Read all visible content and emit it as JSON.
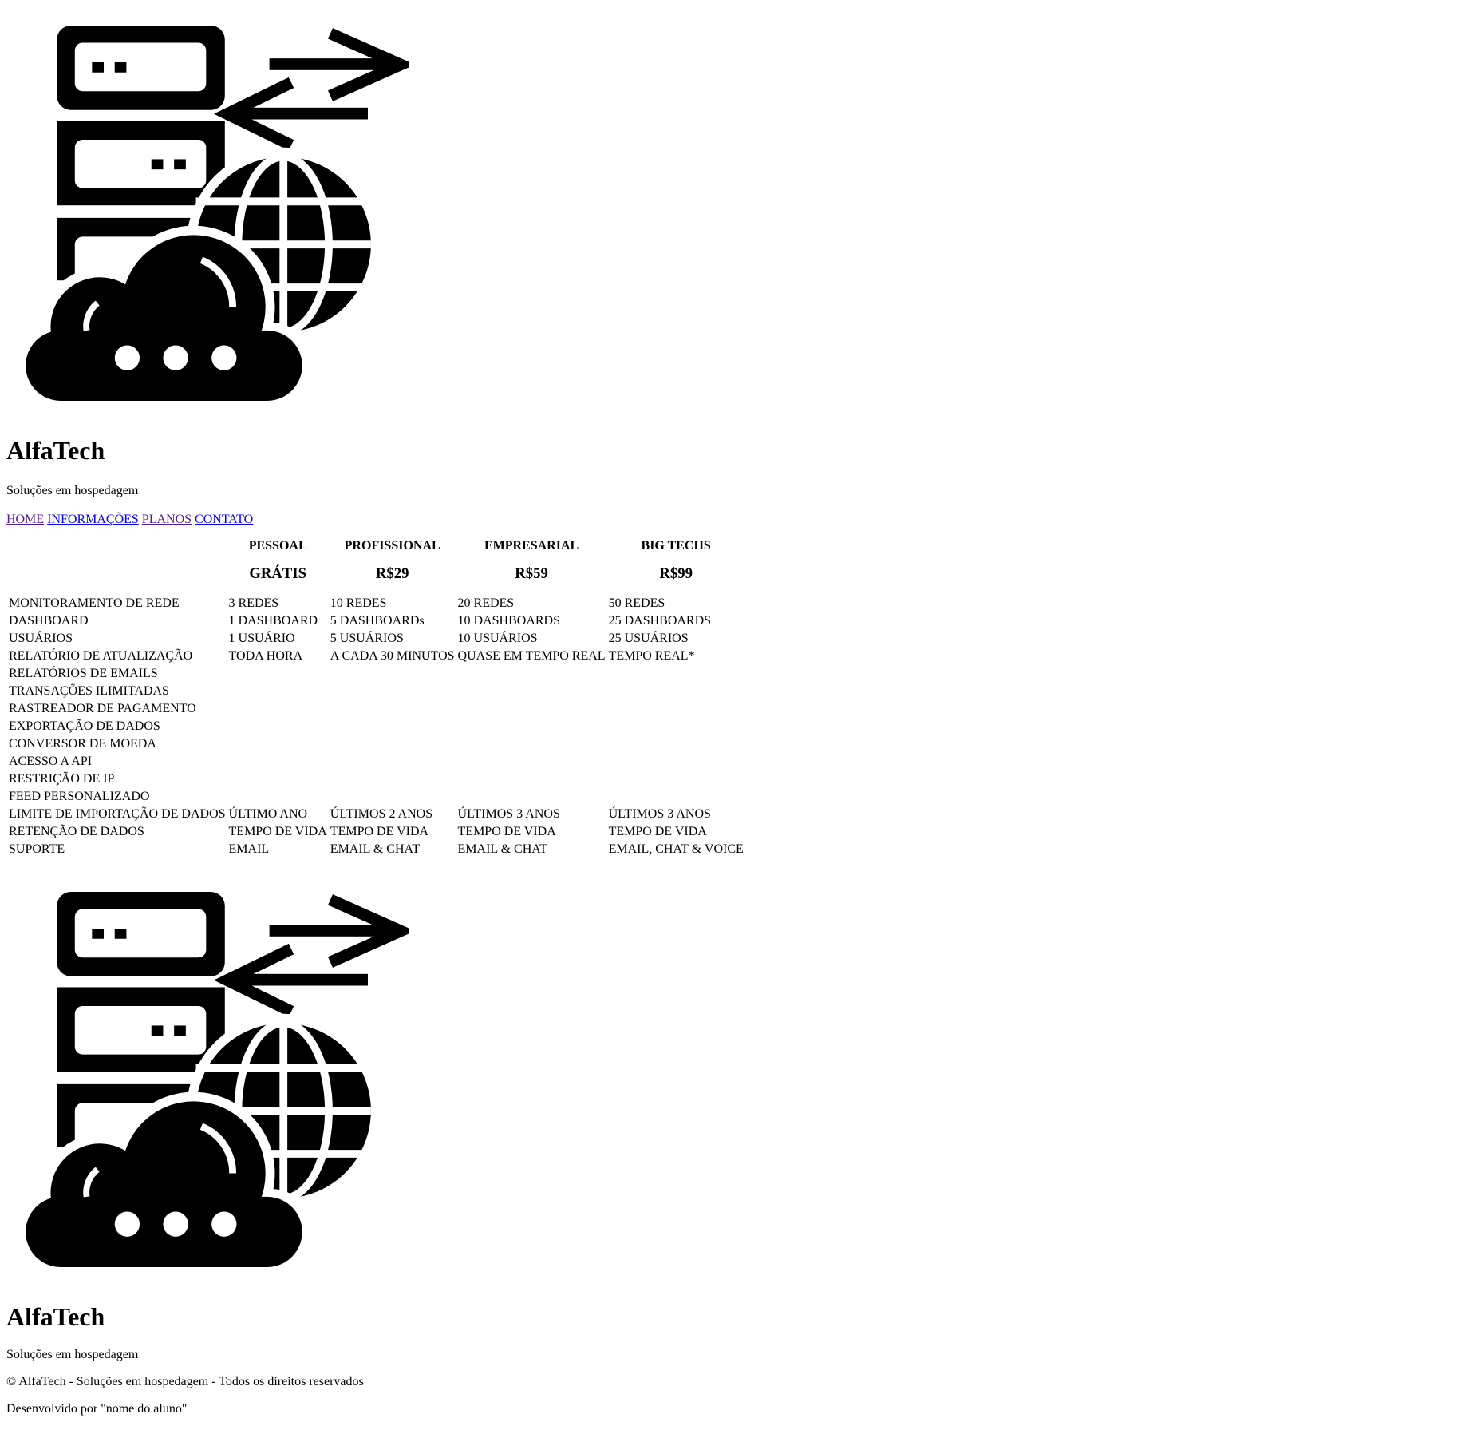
{
  "header": {
    "logo_icon": "server-globe-cloud-icon",
    "brand": "AlfaTech",
    "tagline": "Soluções em hospedagem"
  },
  "nav": {
    "items": [
      "HOME",
      "INFORMAÇÕES",
      "PLANOS",
      "CONTATO"
    ],
    "visited_color": "#551a8b",
    "link_color": "#0000ee"
  },
  "plans": {
    "headers": [
      "PESSOAL",
      "PROFISSIONAL",
      "EMPRESARIAL",
      "BIG TECHS"
    ],
    "prices": [
      "GRÁTIS",
      "R$29",
      "R$59",
      "R$99"
    ],
    "rows": [
      {
        "feature": "MONITORAMENTO DE REDE",
        "values": [
          "3 REDES",
          "10 REDES",
          "20 REDES",
          "50 REDES"
        ]
      },
      {
        "feature": "DASHBOARD",
        "values": [
          "1 DASHBOARD",
          "5 DASHBOARDs",
          "10 DASHBOARDS",
          "25 DASHBOARDS"
        ]
      },
      {
        "feature": "USUÁRIOS",
        "values": [
          "1 USUÁRIO",
          "5 USUÁRIOS",
          "10 USUÁRIOS",
          "25 USUÁRIOS"
        ]
      },
      {
        "feature": "RELATÓRIO DE ATUALIZAÇÃO",
        "values": [
          "TODA HORA",
          "A CADA 30 MINUTOS",
          "QUASE EM TEMPO REAL",
          "TEMPO REAL*"
        ]
      },
      {
        "feature": "RELATÓRIOS DE EMAILS",
        "values": [
          "",
          "",
          "",
          ""
        ]
      },
      {
        "feature": "TRANSAÇÕES ILIMITADAS",
        "values": [
          "",
          "",
          "",
          ""
        ]
      },
      {
        "feature": "RASTREADOR DE PAGAMENTO",
        "values": [
          "",
          "",
          "",
          ""
        ]
      },
      {
        "feature": "EXPORTAÇÃO DE DADOS",
        "values": [
          "",
          "",
          "",
          ""
        ]
      },
      {
        "feature": "CONVERSOR DE MOEDA",
        "values": [
          "",
          "",
          "",
          ""
        ]
      },
      {
        "feature": "ACESSO A API",
        "values": [
          "",
          "",
          "",
          ""
        ]
      },
      {
        "feature": "RESTRIÇÃO DE IP",
        "values": [
          "",
          "",
          "",
          ""
        ]
      },
      {
        "feature": "FEED PERSONALIZADO",
        "values": [
          "",
          "",
          "",
          ""
        ]
      },
      {
        "feature": "LIMITE DE IMPORTAÇÃO DE DADOS",
        "values": [
          "ÚLTIMO ANO",
          "ÚLTIMOS 2 ANOS",
          "ÚLTIMOS 3 ANOS",
          "ÚLTIMOS 3 ANOS"
        ]
      },
      {
        "feature": "RETENÇÃO DE DADOS",
        "values": [
          "TEMPO DE VIDA",
          "TEMPO DE VIDA",
          "TEMPO DE VIDA",
          "TEMPO DE VIDA"
        ]
      },
      {
        "feature": "SUPORTE",
        "values": [
          "EMAIL",
          "EMAIL & CHAT",
          "EMAIL & CHAT",
          "EMAIL, CHAT & VOICE"
        ]
      }
    ]
  },
  "footer": {
    "logo_icon": "server-globe-cloud-icon",
    "brand": "AlfaTech",
    "tagline": "Soluções em hospedagem",
    "copyright": "© AlfaTech - Soluções em hospedagem - Todos os direitos reservados",
    "developer": "Desenvolvido por \"nome do aluno\""
  }
}
